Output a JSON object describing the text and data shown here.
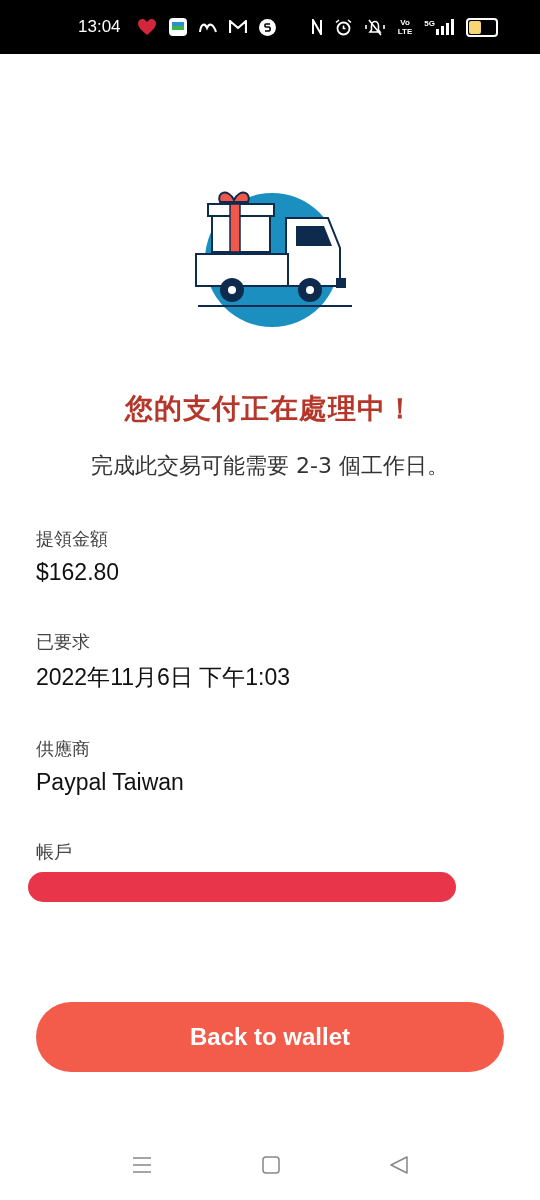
{
  "status_bar": {
    "time": "13:04",
    "volte": [
      "Vo",
      "LTE"
    ],
    "network": "5G"
  },
  "title": "您的支付正在處理中！",
  "subtitle": "完成此交易可能需要 2-3 個工作日。",
  "details": [
    {
      "label": "提領金額",
      "value": "$162.80"
    },
    {
      "label": "已要求",
      "value": "2022年11月6日 下午1:03"
    },
    {
      "label": "供應商",
      "value": "Paypal Taiwan"
    },
    {
      "label": "帳戶",
      "redacted": true
    }
  ],
  "button": {
    "label": "Back to wallet"
  }
}
